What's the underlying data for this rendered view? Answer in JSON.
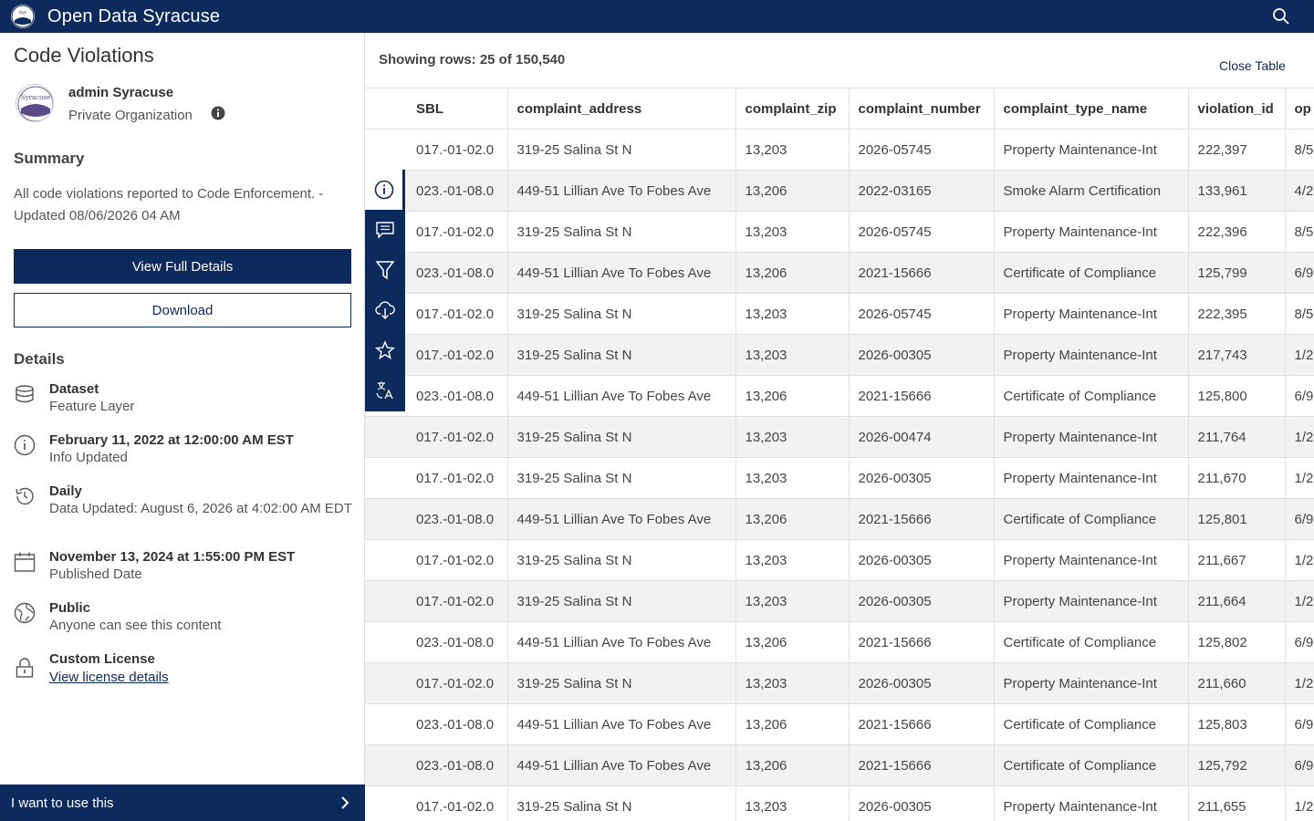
{
  "header": {
    "site_title": "Open Data Syracuse",
    "logo_icon": "syracuse-seal-icon",
    "search_icon": "search-icon"
  },
  "sidebar": {
    "dataset_title": "Code Violations",
    "owner": {
      "name": "admin Syracuse",
      "org": "Private Organization"
    },
    "summary_heading": "Summary",
    "summary_text": "All code violations reported to Code Enforcement. - Updated 08/06/2026 04 AM",
    "view_details_label": "View Full Details",
    "download_label": "Download",
    "details_heading": "Details",
    "details": [
      {
        "icon": "database-icon",
        "strong": "Dataset",
        "sub": "Feature Layer"
      },
      {
        "icon": "info-icon",
        "strong": "February 11, 2022 at 12:00:00 AM EST",
        "sub": "Info Updated"
      },
      {
        "icon": "history-icon",
        "strong": "Daily",
        "sub": "Data Updated: August 6, 2026 at 4:02:00 AM EDT"
      },
      {
        "icon": "calendar-icon",
        "strong": "November 13, 2024 at 1:55:00 PM EST",
        "sub": "Published Date"
      },
      {
        "icon": "globe-icon",
        "strong": "Public",
        "sub": "Anyone can see this content"
      },
      {
        "icon": "lock-icon",
        "strong": "Custom License",
        "link": "View license details"
      }
    ],
    "footer_label": "I want to use this"
  },
  "table_panel": {
    "rows_count": "Showing rows: 25 of 150,540",
    "close_label": "Close Table",
    "columns": [
      "",
      "SBL",
      "complaint_address",
      "complaint_zip",
      "complaint_number",
      "complaint_type_name",
      "violation_id",
      "op"
    ],
    "rows": [
      [
        "017.-01-02.0",
        "319-25 Salina St N",
        "13,203",
        "2026-05745",
        "Property Maintenance-Int",
        "222,397",
        "8/5"
      ],
      [
        "023.-01-08.0",
        "449-51 Lillian Ave To Fobes Ave",
        "13,206",
        "2022-03165",
        "Smoke Alarm Certification",
        "133,961",
        "4/2"
      ],
      [
        "017.-01-02.0",
        "319-25 Salina St N",
        "13,203",
        "2026-05745",
        "Property Maintenance-Int",
        "222,396",
        "8/5"
      ],
      [
        "023.-01-08.0",
        "449-51 Lillian Ave To Fobes Ave",
        "13,206",
        "2021-15666",
        "Certificate of Compliance",
        "125,799",
        "6/9"
      ],
      [
        "017.-01-02.0",
        "319-25 Salina St N",
        "13,203",
        "2026-05745",
        "Property Maintenance-Int",
        "222,395",
        "8/5"
      ],
      [
        "017.-01-02.0",
        "319-25 Salina St N",
        "13,203",
        "2026-00305",
        "Property Maintenance-Int",
        "217,743",
        "1/2"
      ],
      [
        "023.-01-08.0",
        "449-51 Lillian Ave To Fobes Ave",
        "13,206",
        "2021-15666",
        "Certificate of Compliance",
        "125,800",
        "6/9"
      ],
      [
        "017.-01-02.0",
        "319-25 Salina St N",
        "13,203",
        "2026-00474",
        "Property Maintenance-Int",
        "211,764",
        "1/2"
      ],
      [
        "017.-01-02.0",
        "319-25 Salina St N",
        "13,203",
        "2026-00305",
        "Property Maintenance-Int",
        "211,670",
        "1/2"
      ],
      [
        "023.-01-08.0",
        "449-51 Lillian Ave To Fobes Ave",
        "13,206",
        "2021-15666",
        "Certificate of Compliance",
        "125,801",
        "6/9"
      ],
      [
        "017.-01-02.0",
        "319-25 Salina St N",
        "13,203",
        "2026-00305",
        "Property Maintenance-Int",
        "211,667",
        "1/2"
      ],
      [
        "017.-01-02.0",
        "319-25 Salina St N",
        "13,203",
        "2026-00305",
        "Property Maintenance-Int",
        "211,664",
        "1/2"
      ],
      [
        "023.-01-08.0",
        "449-51 Lillian Ave To Fobes Ave",
        "13,206",
        "2021-15666",
        "Certificate of Compliance",
        "125,802",
        "6/9"
      ],
      [
        "017.-01-02.0",
        "319-25 Salina St N",
        "13,203",
        "2026-00305",
        "Property Maintenance-Int",
        "211,660",
        "1/2"
      ],
      [
        "023.-01-08.0",
        "449-51 Lillian Ave To Fobes Ave",
        "13,206",
        "2021-15666",
        "Certificate of Compliance",
        "125,803",
        "6/9"
      ],
      [
        "023.-01-08.0",
        "449-51 Lillian Ave To Fobes Ave",
        "13,206",
        "2021-15666",
        "Certificate of Compliance",
        "125,792",
        "6/9"
      ],
      [
        "017.-01-02.0",
        "319-25 Salina St N",
        "13,203",
        "2026-00305",
        "Property Maintenance-Int",
        "211,655",
        "1/2"
      ]
    ]
  },
  "action_rail": [
    {
      "icon": "info-icon",
      "active": true
    },
    {
      "icon": "comment-icon",
      "active": false
    },
    {
      "icon": "filter-icon",
      "active": false
    },
    {
      "icon": "cloud-download-icon",
      "active": false
    },
    {
      "icon": "star-icon",
      "active": false
    },
    {
      "icon": "translate-icon",
      "active": false
    }
  ],
  "colors": {
    "brand": "#0d2a5c",
    "row_alt": "#f2f2f2"
  }
}
